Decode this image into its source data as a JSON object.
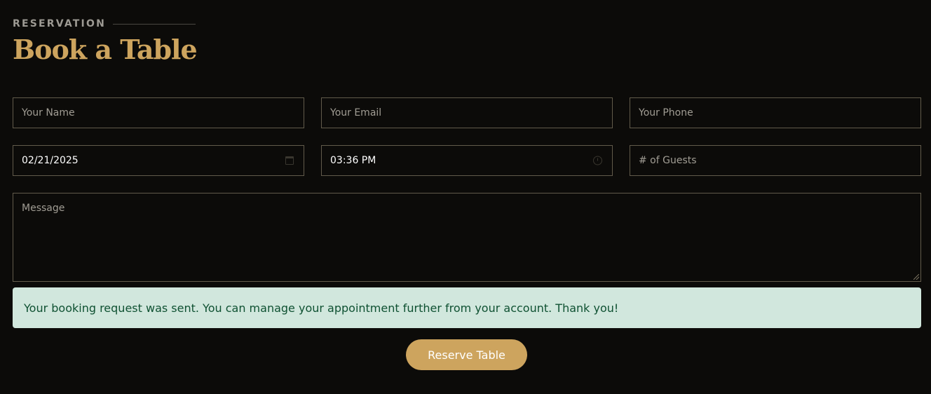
{
  "section": {
    "label": "RESERVATION",
    "title": "Book a Table"
  },
  "form": {
    "name_placeholder": "Your Name",
    "email_placeholder": "Your Email",
    "phone_placeholder": "Your Phone",
    "date_value": "02/21/2025",
    "time_value": "03:36 PM",
    "guests_placeholder": "# of Guests",
    "message_placeholder": "Message"
  },
  "alert": {
    "text": "Your booking request was sent. You can manage your appointment further from your account. Thank you!"
  },
  "submit_label": "Reserve Table",
  "icons": {
    "date": "calendar-icon",
    "time": "clock-icon"
  },
  "colors": {
    "accent": "#cda45e",
    "background": "#0c0b09",
    "alert_bg": "#d1e7dd",
    "alert_text": "#0f5132"
  }
}
